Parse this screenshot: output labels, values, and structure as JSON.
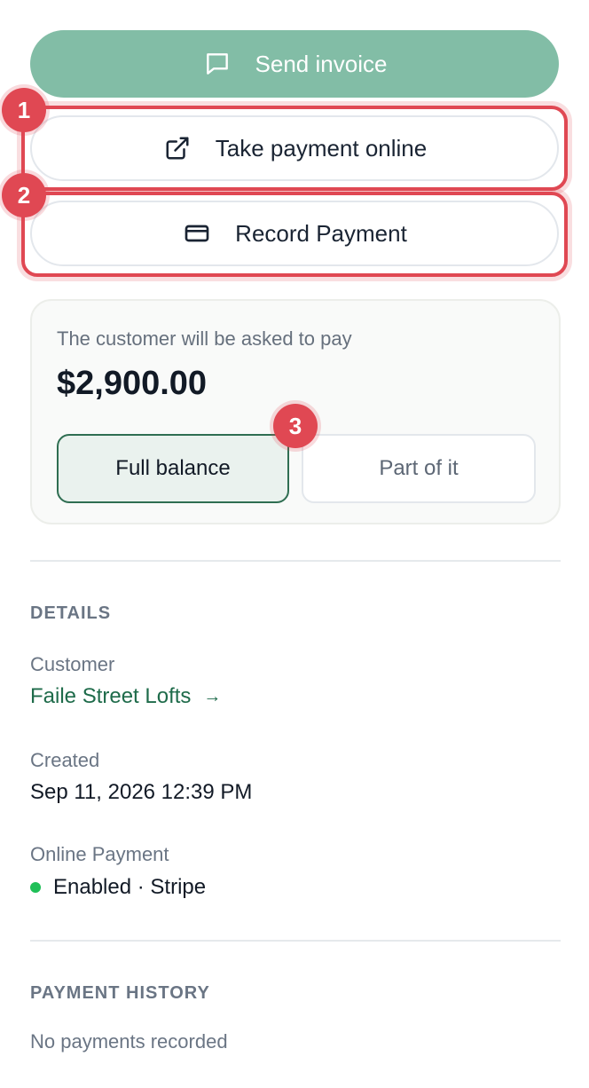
{
  "actions": {
    "send_invoice": "Send invoice",
    "take_payment_online": "Take payment online",
    "record_payment": "Record Payment"
  },
  "annotations": [
    "1",
    "2",
    "3"
  ],
  "payment_card": {
    "caption": "The customer will be asked to pay",
    "amount": "$2,900.00",
    "options": {
      "full": "Full balance",
      "part": "Part of it",
      "selected": "full"
    }
  },
  "details": {
    "title": "DETAILS",
    "customer_label": "Customer",
    "customer_value": "Faile Street Lofts",
    "customer_arrow": "→",
    "created_label": "Created",
    "created_value": "Sep 11, 2026 12:39 PM",
    "online_payment_label": "Online Payment",
    "online_payment_value": "Enabled · Stripe"
  },
  "payment_history": {
    "title": "PAYMENT HISTORY",
    "empty": "No payments recorded"
  },
  "colors": {
    "primary_green": "#82bda6",
    "link_green": "#1e6b4a",
    "status_dot": "#1fbf57",
    "annotation_red": "#e04853"
  },
  "icons": {
    "send_invoice": "message-square-icon",
    "take_payment_online": "external-link-icon",
    "record_payment": "credit-card-icon"
  }
}
